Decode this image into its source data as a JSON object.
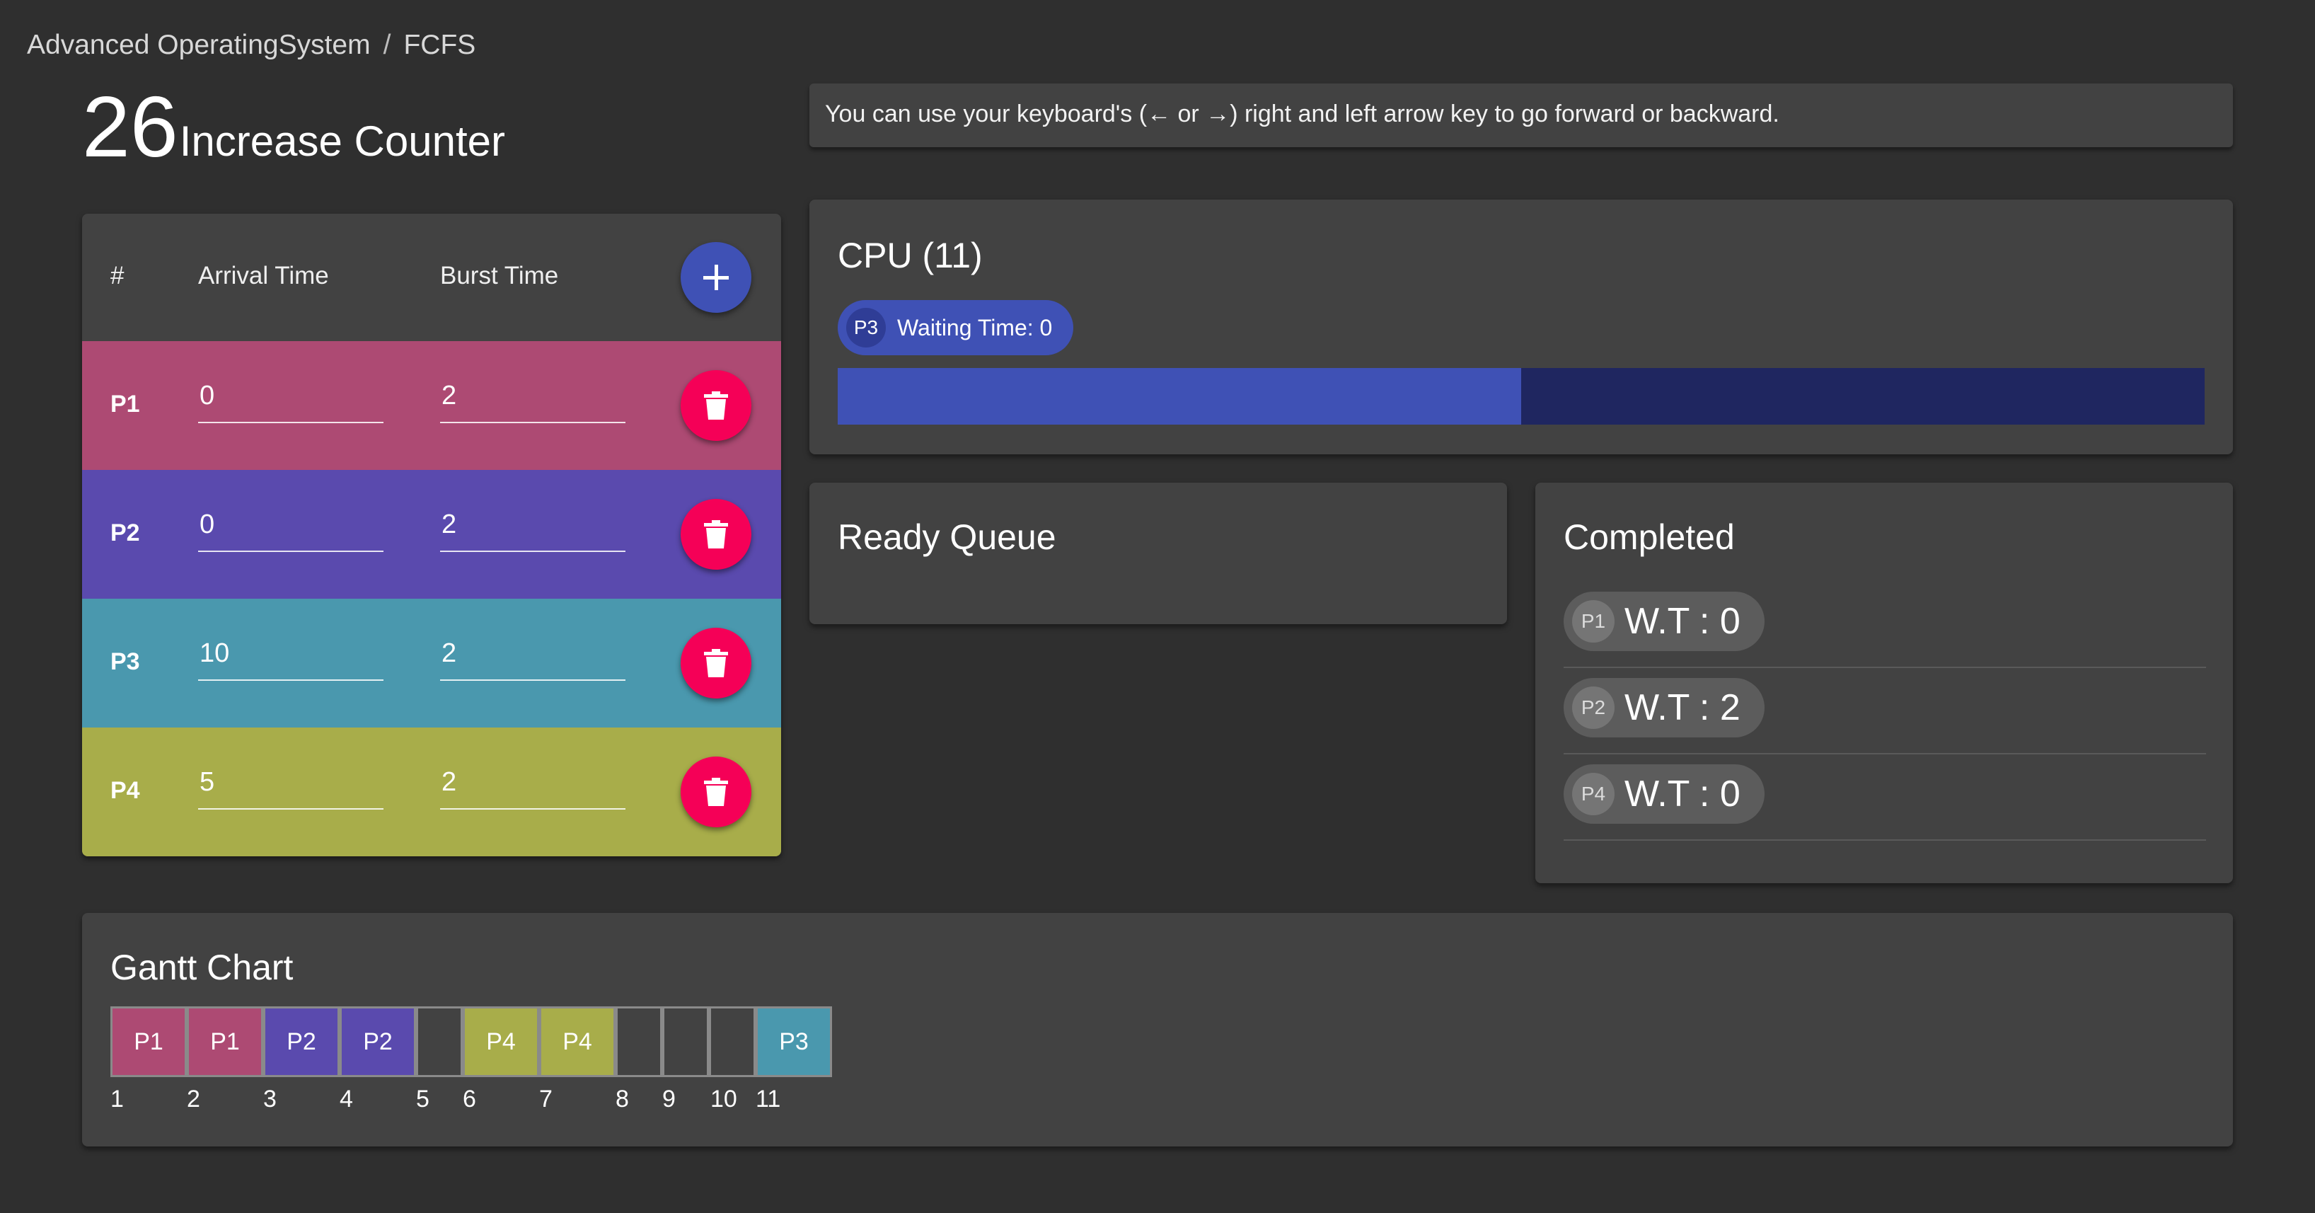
{
  "breadcrumb": {
    "app": "Advanced OperatingSystem",
    "sep": "/",
    "page": "FCFS"
  },
  "counter": {
    "value": "26",
    "label": "Increase Counter"
  },
  "hint": "You can use your keyboard's (← or →) right and left arrow key to go forward or backward.",
  "table": {
    "headers": {
      "id": "#",
      "arrival": "Arrival Time",
      "burst": "Burst Time"
    },
    "rows": [
      {
        "id": "P1",
        "arrival": "0",
        "burst": "2",
        "color": "#ad4a73"
      },
      {
        "id": "P2",
        "arrival": "0",
        "burst": "2",
        "color": "#5a4aae"
      },
      {
        "id": "P3",
        "arrival": "10",
        "burst": "2",
        "color": "#4a98ae"
      },
      {
        "id": "P4",
        "arrival": "5",
        "burst": "2",
        "color": "#a8ad4a"
      }
    ]
  },
  "cpu": {
    "title": "CPU (11)",
    "process": "P3",
    "waiting": "Waiting Time: 0",
    "progress": 0.5
  },
  "ready_queue": {
    "title": "Ready Queue"
  },
  "completed": {
    "title": "Completed",
    "items": [
      {
        "id": "P1",
        "wt": "W.T : 0"
      },
      {
        "id": "P2",
        "wt": "W.T : 2"
      },
      {
        "id": "P4",
        "wt": "W.T : 0"
      }
    ]
  },
  "gantt": {
    "title": "Gantt Chart",
    "cells": [
      {
        "label": "P1",
        "color": "#ad4a73"
      },
      {
        "label": "P1",
        "color": "#ad4a73"
      },
      {
        "label": "P2",
        "color": "#5a4aae"
      },
      {
        "label": "P2",
        "color": "#5a4aae"
      },
      {
        "label": "",
        "color": "#424242"
      },
      {
        "label": "P4",
        "color": "#a8ad4a"
      },
      {
        "label": "P4",
        "color": "#a8ad4a"
      },
      {
        "label": "",
        "color": "#424242"
      },
      {
        "label": "",
        "color": "#424242"
      },
      {
        "label": "",
        "color": "#424242"
      },
      {
        "label": "P3",
        "color": "#4a98ae"
      }
    ],
    "ticks": [
      "1",
      "2",
      "3",
      "4",
      "5",
      "6",
      "7",
      "8",
      "9",
      "10",
      "11"
    ]
  },
  "colors": {
    "primary": "#3f51b5",
    "danger": "#f50057",
    "background": "#2f2f2f",
    "card": "#424242"
  }
}
